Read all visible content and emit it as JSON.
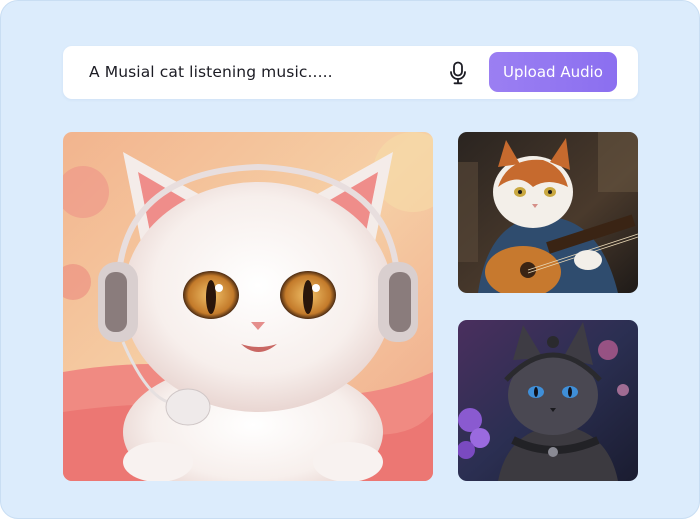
{
  "search": {
    "prompt_text": "A Musial cat listening music.....",
    "mic_icon": "microphone-icon",
    "upload_label": "Upload Audio"
  },
  "gallery": {
    "images": [
      {
        "subject": "white kitten wearing headphones"
      },
      {
        "subject": "orange and white cat playing guitar"
      },
      {
        "subject": "dark grey cat with headset among flowers"
      }
    ]
  },
  "colors": {
    "background": "#dcecfc",
    "button": "#9b7ff2",
    "bar": "#ffffff"
  }
}
